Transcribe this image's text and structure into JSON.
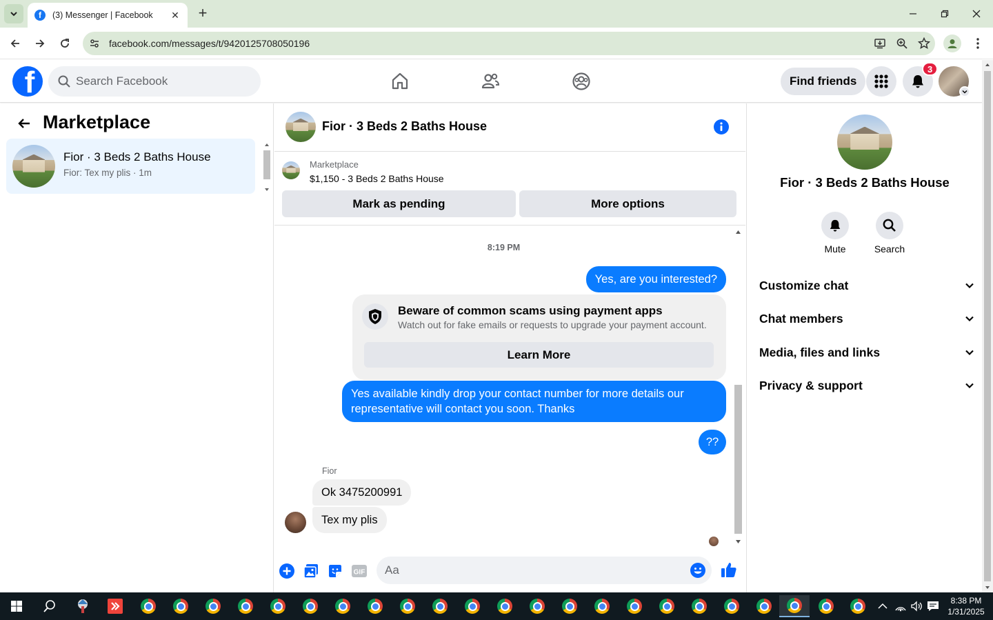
{
  "browser": {
    "tab_title": "(3) Messenger | Facebook",
    "url": "facebook.com/messages/t/9420125708050196",
    "icons": [
      "chevron-down-icon",
      "close-icon",
      "plus-icon",
      "minimize-icon",
      "maximize-icon",
      "back-icon",
      "forward-icon",
      "reload-icon",
      "site-info-icon",
      "install-icon",
      "zoom-icon",
      "star-icon",
      "profile-icon",
      "more-icon"
    ]
  },
  "fb_header": {
    "logo_letter": "f",
    "search_placeholder": "Search Facebook",
    "find_friends": "Find friends",
    "notification_count": "3",
    "nav_icons": [
      "home-icon",
      "friends-icon",
      "groups-icon"
    ]
  },
  "left": {
    "title": "Marketplace",
    "conversation": {
      "name": "Fior · 3 Beds 2 Baths House",
      "preview": "Fior: Tex my plis · 1m"
    }
  },
  "chat": {
    "title": "Fior · 3 Beds 2 Baths House",
    "listing": {
      "category": "Marketplace",
      "price_title": "$1,150 - 3 Beds 2 Baths House",
      "mark_pending": "Mark as pending",
      "more_options": "More options"
    },
    "timestamp": "8:19 PM",
    "messages": {
      "out1": "Yes, are you interested?",
      "out2": "Yes available kindly drop your contact number for more details our representative will contact you soon. Thanks",
      "out3": "??",
      "sender": "Fior",
      "in1": "Ok 3475200991",
      "in2": "Tex my plis"
    },
    "scam_notice": {
      "title": "Beware of common scams using payment apps",
      "description": "Watch out for fake emails or requests to upgrade your payment account.",
      "button": "Learn More"
    },
    "composer_placeholder": "Aa"
  },
  "right": {
    "name": "Fior · 3 Beds 2 Baths House",
    "actions": {
      "mute": "Mute",
      "search": "Search"
    },
    "sections": {
      "customize": "Customize chat",
      "members": "Chat members",
      "media": "Media, files and links",
      "privacy": "Privacy & support"
    }
  },
  "taskbar": {
    "time": "8:38 PM",
    "date": "1/31/2025"
  },
  "colors": {
    "fb_blue": "#0866ff",
    "bubble_blue": "#0a7cff",
    "badge_red": "#e41e3f",
    "chrome_green": "#dce9d8"
  }
}
